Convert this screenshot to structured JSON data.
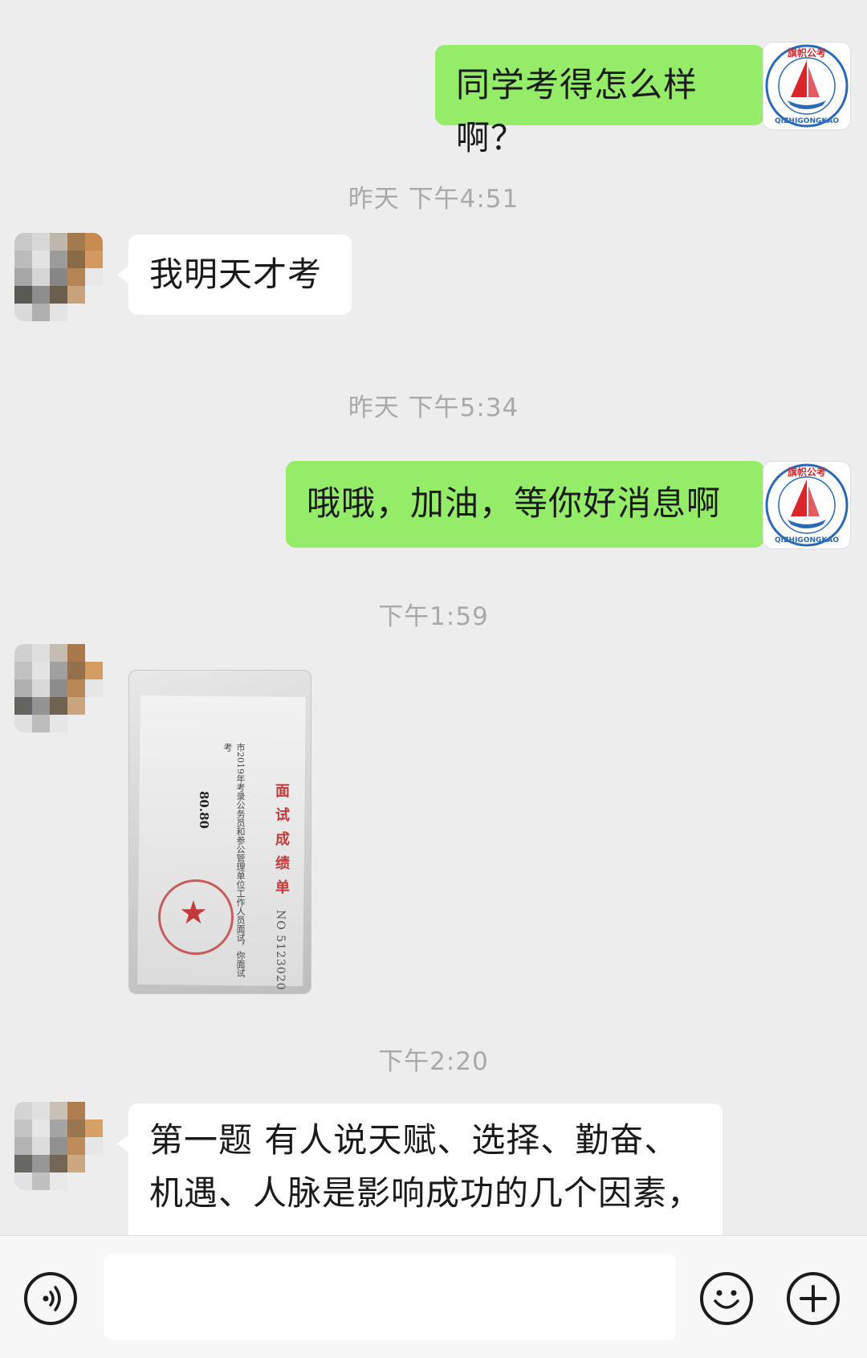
{
  "messages": {
    "m1": {
      "text": "同学考得怎么样啊？"
    },
    "t1": "昨天 下午4:51",
    "m2": {
      "text": "我明天才考"
    },
    "t2": "昨天 下午5:34",
    "m3": {
      "text": "哦哦，加油，等你好消息啊"
    },
    "t3": "下午1:59",
    "m4": {
      "photo": {
        "title": "面试成绩单",
        "number": "NO 5123020",
        "score": "80.80",
        "year_line": "市2019年考录公务员和参公管理单位工作人员面试，你面试考"
      }
    },
    "t4": "下午2:20",
    "m5": {
      "line1": "第一题 有人说天赋、选择、勤奋、",
      "line2": "机遇、人脉是影响成功的几个因素，"
    }
  },
  "self_avatar": {
    "logo_top": "旗帜公考",
    "logo_bottom": "QIZHIGONGKAO"
  },
  "toolbar": {
    "voice_icon": "voice-icon",
    "emoji_icon": "emoji-icon",
    "plus_icon": "plus-icon",
    "input_value": ""
  },
  "colors": {
    "self_bubble": "#95ec69",
    "other_bubble": "#ffffff",
    "background": "#ededed",
    "timestamp": "#a9a9a9",
    "logo_red": "#d9262c",
    "logo_blue": "#2a69b8"
  }
}
